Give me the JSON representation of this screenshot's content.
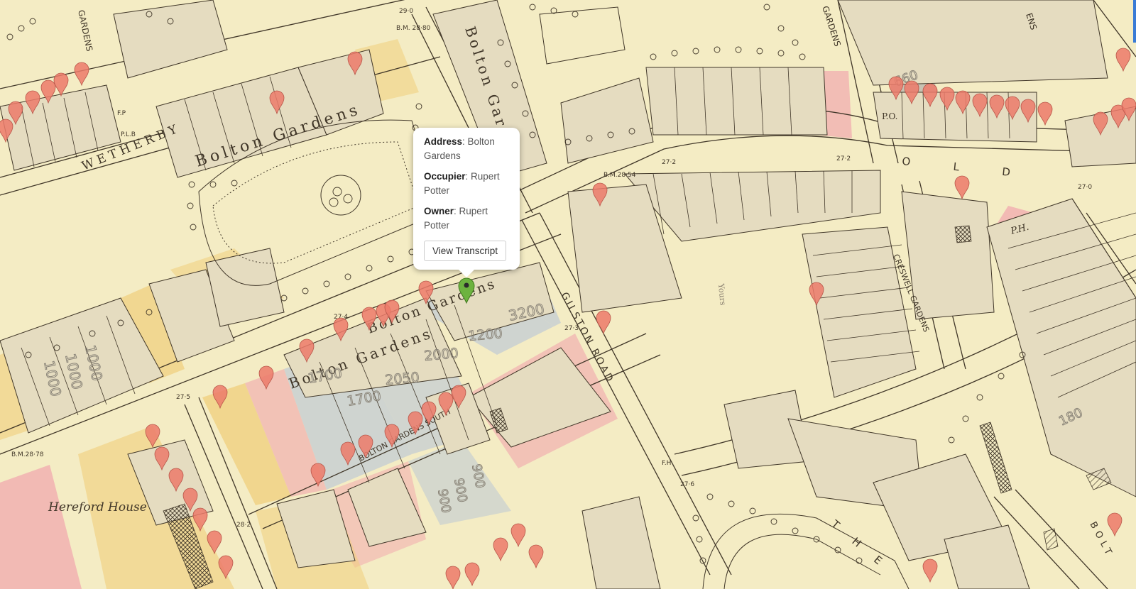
{
  "map": {
    "labels": {
      "weatherby": "W E T H E R B Y",
      "bolton_gardens_top": "Bolton Gardens",
      "bolton_gardens_vertical": "Bolton Gardens",
      "bolton_gardens_mid": "Bolton Gardens",
      "bolton_gardens_lower": "Bolton Gardens",
      "bolton_gardens_south": "BOLTON GARDENS SOUTH",
      "gilston_road": "GILSTON ROAD",
      "old": "O L D",
      "creswell_gardens": "CRESWELL GARDENS",
      "hereford_house": "Hereford House",
      "the": "T H E",
      "gardens_top_left": "GARDENS",
      "gardens_top_mid": "GARDENS",
      "ens_top_right": "ENS",
      "bolt_right": "BOLT",
      "po": "P.O.",
      "ph": "P.H.",
      "yours": "Yours",
      "bm_2880": "B.M.\n28·80",
      "bm_2854": "B.M.28·54",
      "bm_2878": "B.M.28·78",
      "spot_290": "29·0",
      "spot_272a": "27·2",
      "spot_272b": "27·2",
      "spot_270": "27·0",
      "spot_274": "27·4",
      "spot_273": "27·3",
      "spot_275": "27·5",
      "spot_276": "27·6",
      "spot_282": "28·2",
      "rent_1000a": "1000",
      "rent_1000b": "1000",
      "rent_1000c": "1000",
      "rent_3200": "3200",
      "rent_1200": "1200",
      "rent_2000": "2000",
      "rent_2050": "2050",
      "rent_1700a": "1700",
      "rent_1700b": "1700",
      "rent_900a": "900",
      "rent_900b": "900",
      "rent_900c": "900",
      "rent_660": "660",
      "rent_180": "180",
      "fp": "F.P",
      "plb": "P.L.B",
      "fh": "F.H"
    },
    "colors": {
      "paper": "#f4ecc4",
      "building": "#e5dcc0",
      "pink": "#f1b1b1",
      "yellow": "#f0cf7c",
      "blue": "#c5ced3",
      "ink": "#403628",
      "marker": "#ec7a6a",
      "selected_marker": "#6db33f"
    },
    "marker_icon": "map-pin-icon",
    "selected_marker_icon": "selected-map-pin-icon"
  },
  "popup": {
    "address_label": "Address",
    "address_value": "Bolton Gardens",
    "occupier_label": "Occupier",
    "occupier_value": "Rupert Potter",
    "owner_label": "Owner",
    "owner_value": "Rupert Potter",
    "button_label": "View Transcript"
  }
}
